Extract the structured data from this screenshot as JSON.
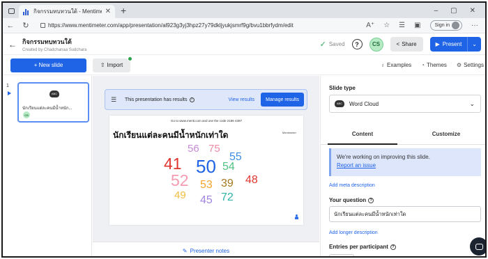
{
  "browser": {
    "tab_title": "กิจกรรมทบทวนใต้ - Mentimeter",
    "tab_close": "✕",
    "new_tab": "+",
    "url": "https://www.mentimeter.com/app/presentation/al923g3yj3hpz27y79dkljyukjsmrf9g/bvu1bbrfydm/edit",
    "sign_in": "Sign in",
    "win_min": "–",
    "win_max": "▢",
    "win_close": "✕"
  },
  "header": {
    "title": "กิจกรรมทบทวนใต้",
    "creator": "Created by Chadchanaa Sudchara",
    "saved": "Saved",
    "avatar_initials": "CS",
    "share": "Share",
    "present": "Present"
  },
  "toolbar": {
    "new_slide": "+ New slide",
    "import": "Import",
    "examples": "Examples",
    "themes": "Themes",
    "settings": "Settings"
  },
  "slides": [
    {
      "number": "1",
      "type_icon": "ABC",
      "title": "นักเรียนแต่ละคนมีน้ำหนัก...",
      "avatar": "CS"
    }
  ],
  "banner": {
    "text": "This presentation has results",
    "view_results": "View results",
    "manage_results": "Manage results"
  },
  "slide_preview": {
    "instructions": "Go to www.menti.com and use the code 2186 4397",
    "logo": "Mentimeter",
    "question": "นักเรียนแต่ละคนมีน้ำหนักเท่าใด",
    "words": [
      {
        "text": "56",
        "color": "#c88bd8"
      },
      {
        "text": "75",
        "color": "#f08aa6"
      },
      {
        "text": "55",
        "color": "#3d8ee8"
      },
      {
        "text": "41",
        "color": "#e0352e"
      },
      {
        "text": "50",
        "color": "#1f63e6"
      },
      {
        "text": "54",
        "color": "#52c282"
      },
      {
        "text": "52",
        "color": "#f39bb1"
      },
      {
        "text": "53",
        "color": "#f3a52b"
      },
      {
        "text": "39",
        "color": "#a3761e"
      },
      {
        "text": "48",
        "color": "#e0352e"
      },
      {
        "text": "49",
        "color": "#f0be3e"
      },
      {
        "text": "45",
        "color": "#a184df"
      },
      {
        "text": "72",
        "color": "#2bb3a8"
      }
    ]
  },
  "notes": {
    "label": "Presenter notes"
  },
  "panel": {
    "slide_type_label": "Slide type",
    "slide_type_value": "Word Cloud",
    "tab_content": "Content",
    "tab_customize": "Customize",
    "notice_text": "We're working on improving this slide.",
    "notice_link": "Report an issue",
    "add_meta": "Add meta description",
    "your_question_label": "Your question",
    "question_value": "นักเรียนแต่ละคนมีน้ำหนักเท่าใด",
    "add_longer": "Add longer description",
    "entries_label": "Entries per participant"
  },
  "colors": {
    "accent": "#1f63e6",
    "success": "#2fa85b"
  }
}
